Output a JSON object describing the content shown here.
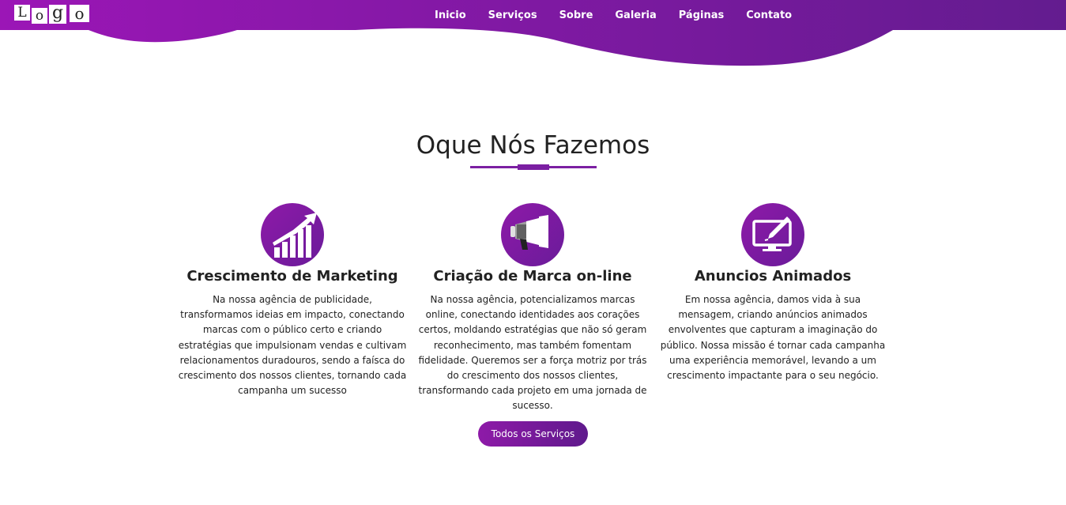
{
  "colors": {
    "primary": "#8e1aa8",
    "primary_dark": "#5f1a8c",
    "text": "#222222",
    "background": "#ffffff"
  },
  "logo": {
    "letters": [
      "L",
      "o",
      "g",
      "o"
    ]
  },
  "nav": {
    "items": [
      {
        "label": "Inicio"
      },
      {
        "label": "Serviços"
      },
      {
        "label": "Sobre"
      },
      {
        "label": "Galeria"
      },
      {
        "label": "Páginas"
      },
      {
        "label": "Contato"
      }
    ]
  },
  "section": {
    "title": "Oque Nós Fazemos"
  },
  "services": [
    {
      "icon": "growth-chart-icon",
      "title": "Crescimento de Marketing",
      "text": "Na nossa agência de publicidade, transformamos ideias em impacto, conectando marcas com o público certo e criando estratégias que impulsionam vendas e cultivam relacionamentos duradouros, sendo a faísca do crescimento dos nossos clientes, tornando cada campanha um sucesso"
    },
    {
      "icon": "megaphone-icon",
      "title": "Criação de Marca on-line",
      "text": "Na nossa agência, potencializamos marcas online, conectando identidades aos corações certos, moldando estratégias que não só geram reconhecimento, mas também fomentam fidelidade. Queremos ser a força motriz por trás do crescimento dos nossos clientes, transformando cada projeto em uma jornada de sucesso."
    },
    {
      "icon": "monitor-pen-icon",
      "title": "Anuncios Animados",
      "text": "Em nossa agência, damos vida à sua mensagem, criando anúncios animados envolventes que capturam a imaginação do público. Nossa missão é tornar cada campanha uma experiência memorável, levando a um crescimento impactante para o seu negócio."
    }
  ],
  "cta": {
    "label": "Todos os Serviços"
  }
}
